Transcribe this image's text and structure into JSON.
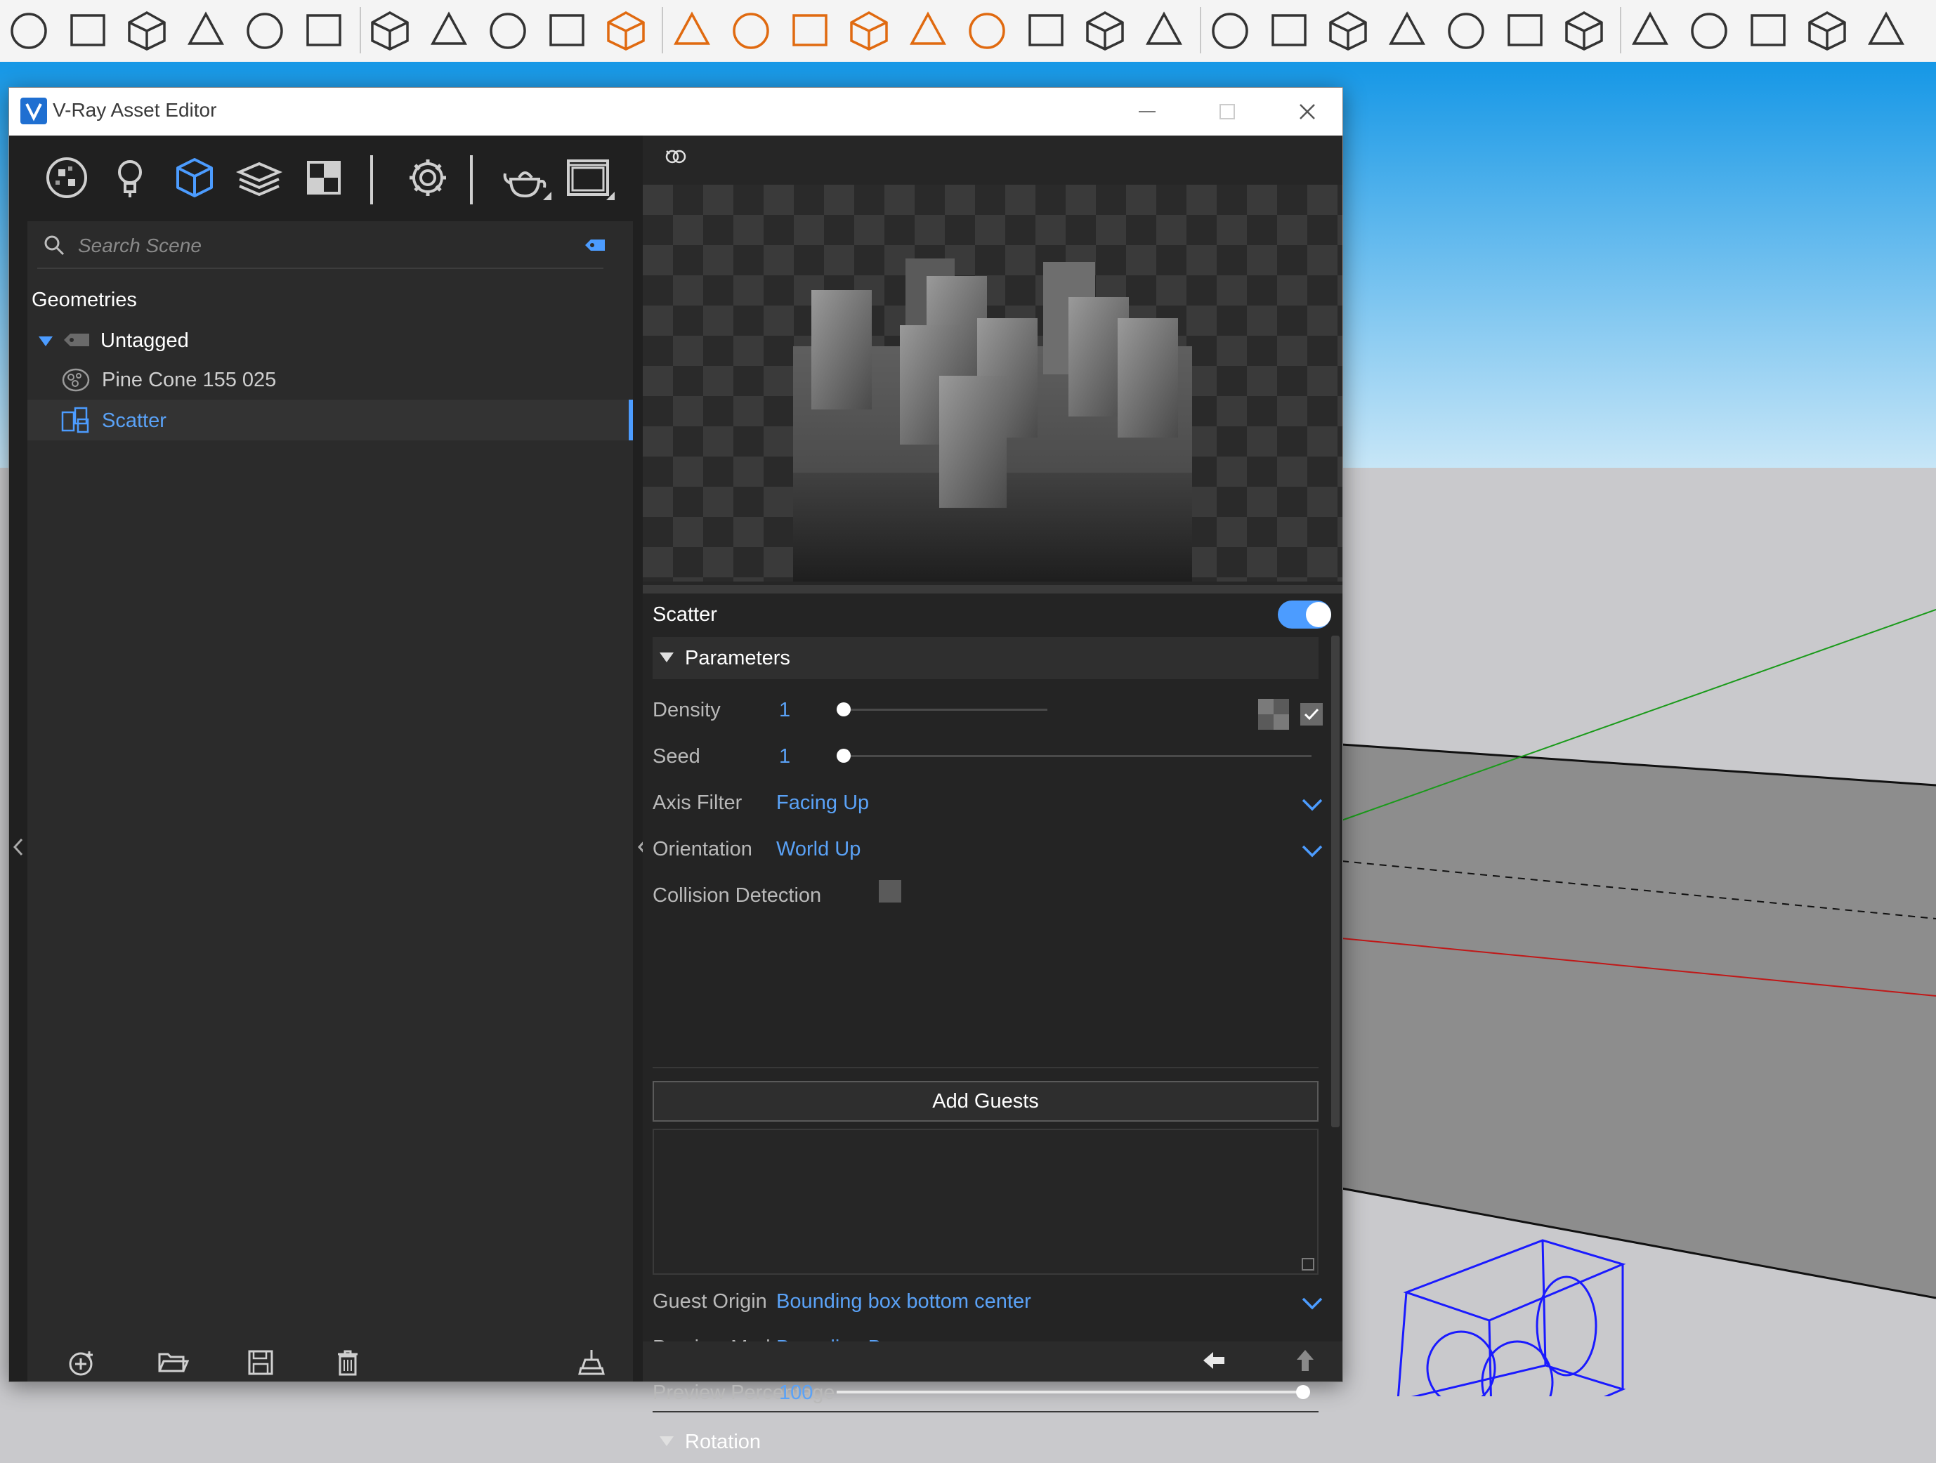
{
  "window": {
    "title": "V-Ray Asset Editor"
  },
  "icons": {
    "app_logo": "v-ray-logo-icon",
    "minimize": "minimize-icon",
    "maximize": "maximize-icon",
    "close": "close-icon",
    "categories": [
      "materials-icon",
      "lights-icon",
      "geometry-icon",
      "render-elements-icon",
      "textures-icon",
      "settings-icon",
      "render-teapot-icon",
      "frame-buffer-icon"
    ]
  },
  "search": {
    "placeholder": "Search Scene"
  },
  "tree": {
    "category": "Geometries",
    "group": "Untagged",
    "items": [
      {
        "label": "Pine Cone 155 025",
        "selected": false
      },
      {
        "label": "Scatter",
        "selected": true
      }
    ]
  },
  "properties": {
    "title": "Scatter",
    "enabled": true,
    "parameters_section": "Parameters",
    "density": {
      "label": "Density",
      "value": "1",
      "level": 0.04,
      "checked": true
    },
    "seed": {
      "label": "Seed",
      "value": "1",
      "level": 0.0
    },
    "axis_filter": {
      "label": "Axis Filter",
      "value": "Facing Up"
    },
    "orientation": {
      "label": "Orientation",
      "value": "World Up"
    },
    "collision_detection": {
      "label": "Collision Detection",
      "checked": false
    },
    "add_guests": "Add Guests",
    "guest_origin": {
      "label": "Guest Origin",
      "value": "Bounding box bottom center"
    },
    "preview_mode": {
      "label": "Preview Mode",
      "value": "Bounding Boxes"
    },
    "preview_percentage": {
      "label": "Preview Percentage",
      "value": "100",
      "level": 1.0
    },
    "rotation_section": "Rotation"
  },
  "colors": {
    "accent": "#4c9cff",
    "value_text": "#5aa2f7",
    "panel_bg": "#202020",
    "list_bg": "#2b2b2b",
    "sky": "#2ea2e8",
    "ground": "#c9c9cc",
    "selection_box": "#1a1aff"
  }
}
